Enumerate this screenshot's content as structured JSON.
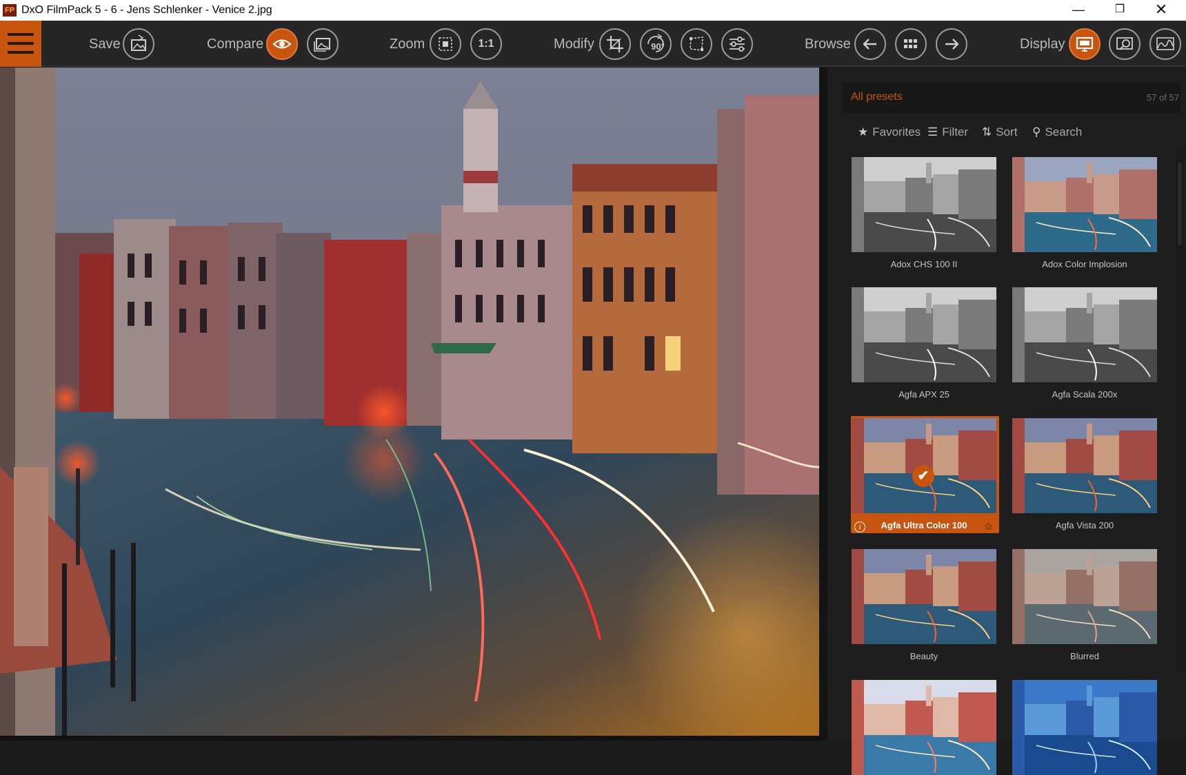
{
  "window": {
    "title": "DxO FilmPack 5 - 6 - Jens Schlenker - Venice 2.jpg",
    "app_icon": "FP"
  },
  "toolbar": {
    "save_label": "Save",
    "compare_label": "Compare",
    "zoom_label": "Zoom",
    "zoom_one_to_one": "1:1",
    "modify_label": "Modify",
    "rotate_label": "90°",
    "browse_label": "Browse",
    "display_label": "Display"
  },
  "panel": {
    "header": "All presets",
    "count": "57 of 57",
    "favorites": "Favorites",
    "filter": "Filter",
    "sort": "Sort",
    "search": "Search",
    "presets": [
      {
        "label": "Adox CHS 100 II",
        "style": "bw",
        "selected": false
      },
      {
        "label": "Adox Color Implosion",
        "style": "color-cool",
        "selected": false
      },
      {
        "label": "Agfa APX 25",
        "style": "bw",
        "selected": false
      },
      {
        "label": "Agfa Scala 200x",
        "style": "bw",
        "selected": false
      },
      {
        "label": "Agfa Ultra Color 100",
        "style": "color",
        "selected": true
      },
      {
        "label": "Agfa Vista 200",
        "style": "color",
        "selected": false
      },
      {
        "label": "Beauty",
        "style": "color",
        "selected": false
      },
      {
        "label": "Blurred",
        "style": "color-muted",
        "selected": false
      },
      {
        "label": "",
        "style": "color-bright",
        "selected": false
      },
      {
        "label": "",
        "style": "blue",
        "selected": false
      }
    ]
  },
  "colors": {
    "accent": "#c8550f",
    "toolbar_bg": "#262626",
    "panel_bg": "#1e1e1e"
  }
}
